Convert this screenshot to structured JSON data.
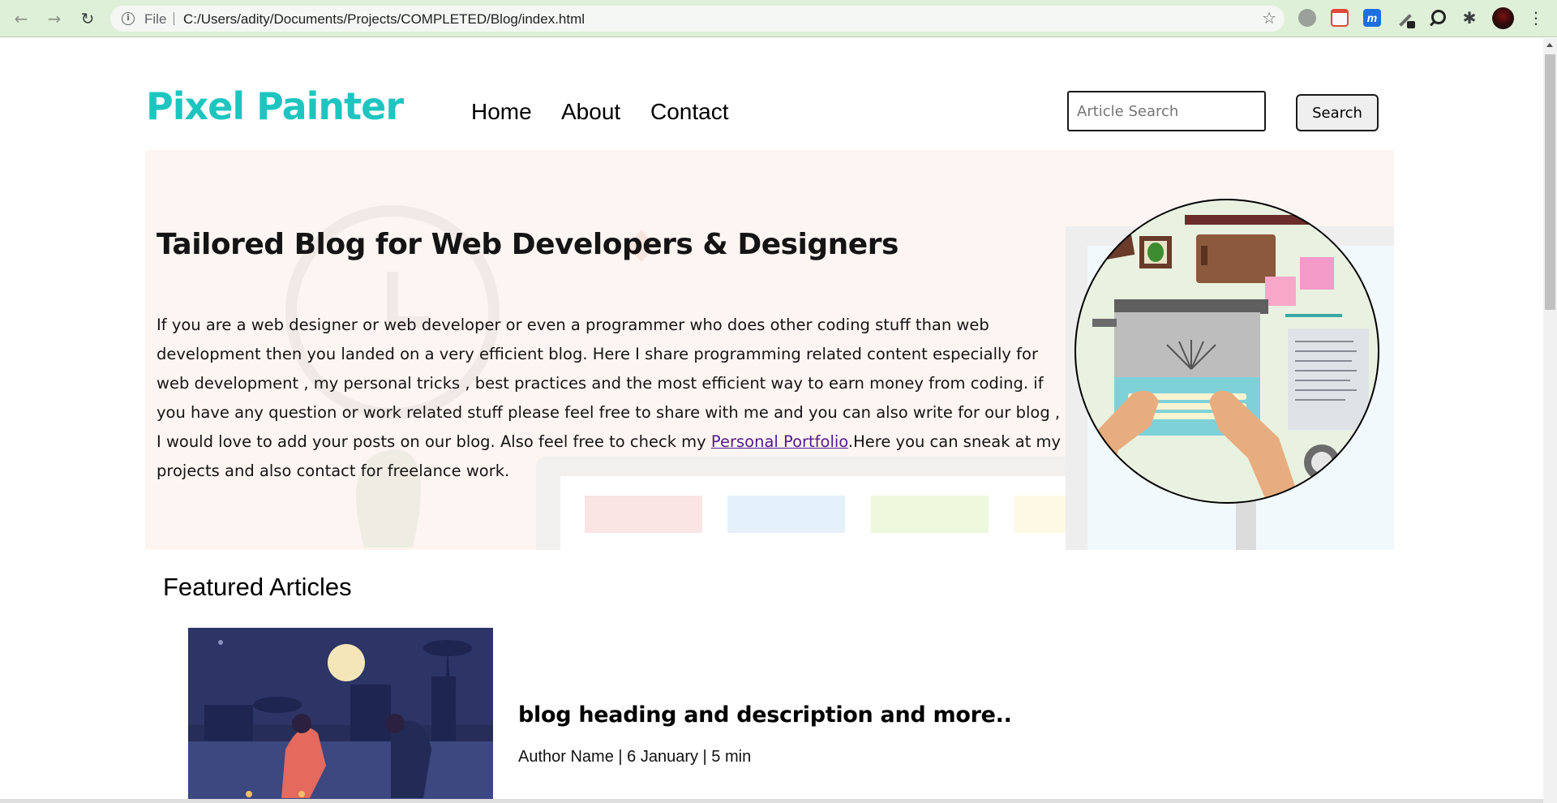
{
  "browser": {
    "scheme_label": "File",
    "url": "C:/Users/adity/Documents/Projects/COMPLETED/Blog/index.html",
    "back_icon": "←",
    "forward_icon": "→",
    "reload_icon": "↻",
    "star_icon": "☆",
    "puzzle_icon": "✱",
    "menu_icon": "⋮",
    "ext_m_label": "m"
  },
  "site": {
    "logo": "Pixel Painter",
    "nav": {
      "home": "Home",
      "about": "About",
      "contact": "Contact"
    },
    "search": {
      "placeholder": "Article Search",
      "button": "Search"
    }
  },
  "hero": {
    "title": "Tailored Blog for Web Developers & Designers",
    "text_before_link": "If you are a web designer or web developer or even a programmer who does other coding stuff than web development then you landed on a very efficient blog. Here I share programming related content especially for web development , my personal tricks , best practices and the most efficient way to earn money from coding. if you have any question or work related stuff please feel free to share with me and you can also write for our blog , I would love to add your posts on our blog. Also feel free to check my ",
    "link_text": "Personal Portfolio",
    "text_after_link": ".Here you can sneak at my projects and also contact for freelance work."
  },
  "featured": {
    "title": "Featured Articles",
    "articles": [
      {
        "heading": "blog heading and description and more..",
        "meta": "Author Name | 6 January | 5 min"
      }
    ]
  }
}
